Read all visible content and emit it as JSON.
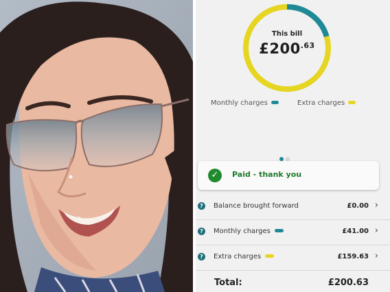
{
  "photo": {
    "subject": "selfie-woman-sunglasses"
  },
  "bill": {
    "label": "This bill",
    "amount_main": "£200",
    "amount_pence": ".63",
    "ring": {
      "monthly_fraction": 0.2047,
      "extra_fraction": 0.7953,
      "monthly_color": "#1f8a95",
      "extra_color": "#e6d521"
    }
  },
  "legend": {
    "monthly_label": "Monthly charges",
    "extra_label": "Extra charges"
  },
  "pager": {
    "count": 2,
    "active_index": 0
  },
  "paid_card": {
    "icon": "check-circle-icon",
    "text": "Paid - thank you",
    "color": "#1f8a2e"
  },
  "rows": [
    {
      "label": "Balance brought forward",
      "value": "£0.00",
      "pill": ""
    },
    {
      "label": "Monthly charges",
      "value": "£41.00",
      "pill": "#1f8a95"
    },
    {
      "label": "Extra charges",
      "value": "£159.63",
      "pill": "#e6d521"
    }
  ],
  "total": {
    "label": "Total:",
    "value": "£200.63"
  }
}
